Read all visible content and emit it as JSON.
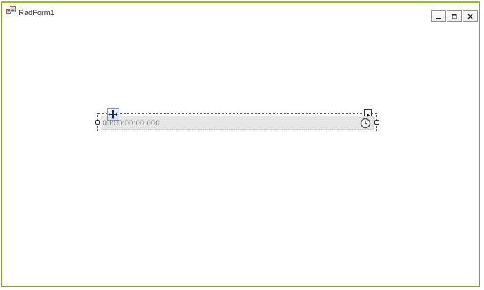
{
  "window": {
    "title": "RadForm1",
    "icon": "form-icon",
    "controls": {
      "minimize": "minimize-icon",
      "maximize": "maximize-icon",
      "close": "close-icon"
    }
  },
  "timespan_picker": {
    "value": "00:00:00:00.000",
    "icon": "clock-icon"
  },
  "designer": {
    "move_icon": "move-icon",
    "smart_tag_icon": "smart-tag-arrow-icon"
  },
  "colors": {
    "border_accent": "#9cbd1e",
    "control_fill": "#e6e6e6"
  }
}
